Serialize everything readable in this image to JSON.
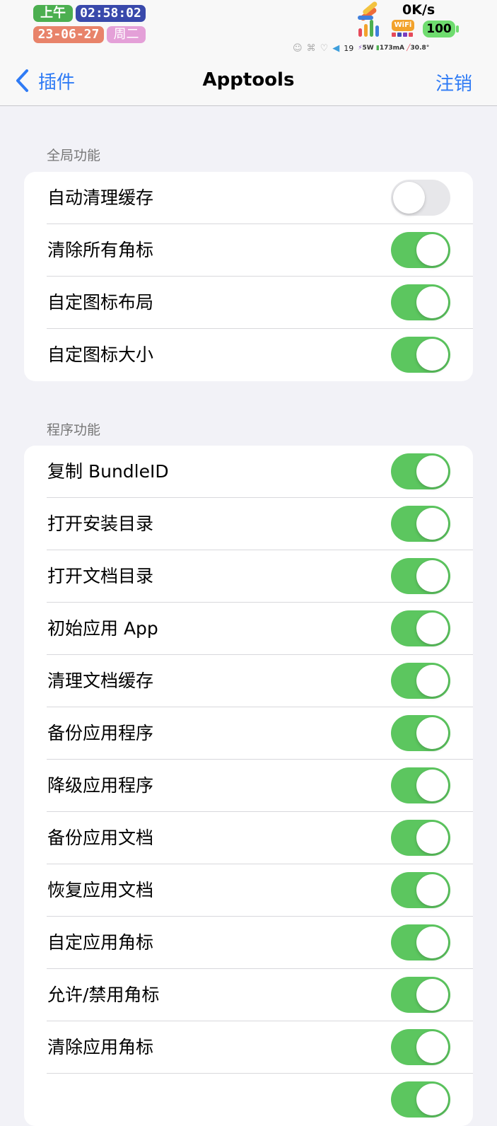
{
  "status_bar": {
    "ampm": "上午",
    "time": "02:58:02",
    "date": "23-06-27",
    "weekday": "周二",
    "net_speed": "0K/s",
    "wifi_label": "WiFi",
    "battery": "100",
    "volume": "19",
    "power": "5W",
    "current": "173mA",
    "temperature": "30.8°"
  },
  "nav": {
    "back_label": "插件",
    "title": "Apptools",
    "action_label": "注销"
  },
  "colors": {
    "accent": "#2f7bf5",
    "toggle_on": "#5cc65f",
    "toggle_off": "#e7e7ea"
  },
  "sections": [
    {
      "header": "全局功能",
      "rows": [
        {
          "label": "自动清理缓存",
          "on": false
        },
        {
          "label": "清除所有角标",
          "on": true
        },
        {
          "label": "自定图标布局",
          "on": true
        },
        {
          "label": "自定图标大小",
          "on": true
        }
      ]
    },
    {
      "header": "程序功能",
      "rows": [
        {
          "label": "复制 BundleID",
          "on": true
        },
        {
          "label": "打开安装目录",
          "on": true
        },
        {
          "label": "打开文档目录",
          "on": true
        },
        {
          "label": "初始应用 App",
          "on": true
        },
        {
          "label": "清理文档缓存",
          "on": true
        },
        {
          "label": "备份应用程序",
          "on": true
        },
        {
          "label": "降级应用程序",
          "on": true
        },
        {
          "label": "备份应用文档",
          "on": true
        },
        {
          "label": "恢复应用文档",
          "on": true
        },
        {
          "label": "自定应用角标",
          "on": true
        },
        {
          "label": "允许/禁用角标",
          "on": true
        },
        {
          "label": "清除应用角标",
          "on": true
        },
        {
          "label": "",
          "on": true
        }
      ]
    }
  ]
}
